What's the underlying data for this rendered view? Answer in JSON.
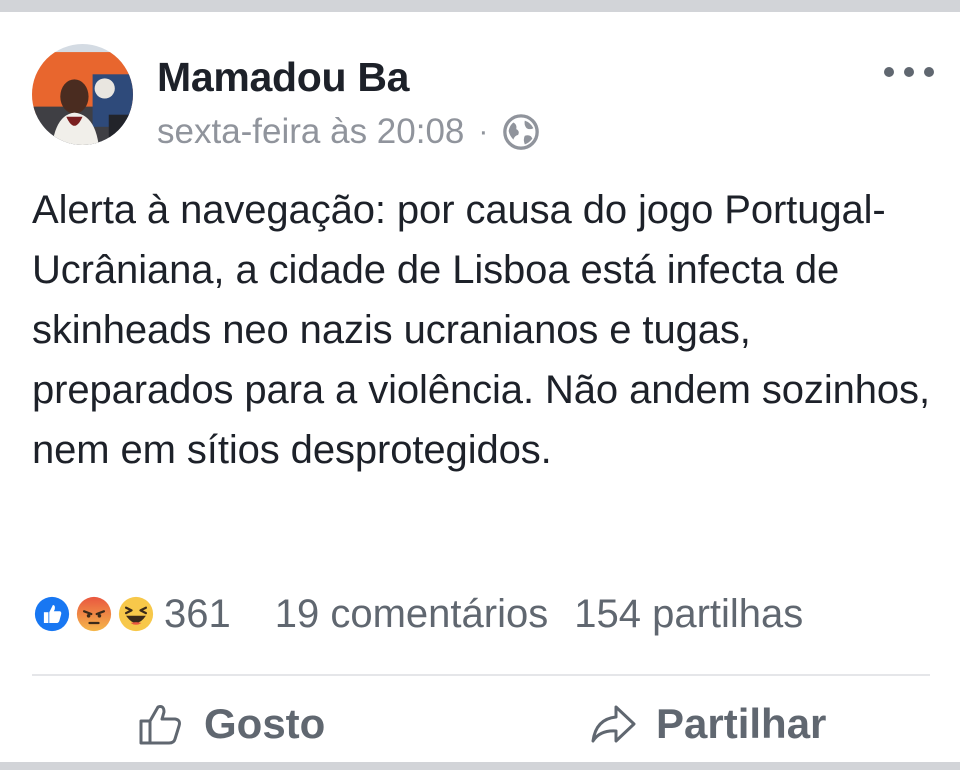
{
  "post": {
    "author": "Mamadou Ba",
    "timestamp": "sexta-feira às 20:08",
    "separator": "·",
    "privacy_icon": "globe-icon",
    "more_icon": "more-options-icon",
    "text": "Alerta à navegação: por causa do jogo Portugal-Ucrâniana, a cidade de Lisboa está infecta de skinheads neo nazis ucranianos e tugas, preparados para a violência. Não andem sozinhos, nem em sítios desprotegidos."
  },
  "stats": {
    "reaction_icons": [
      "like-reaction-icon",
      "angry-reaction-icon",
      "haha-reaction-icon"
    ],
    "reactions_count": "361",
    "comments": "19 comentários",
    "shares": "154 partilhas"
  },
  "actions": {
    "like_label": "Gosto",
    "like_icon": "thumbs-up-icon",
    "share_label": "Partilhar",
    "share_icon": "share-arrow-icon"
  },
  "colors": {
    "text_primary": "#1d2129",
    "text_secondary": "#90949c",
    "action_gray": "#606770",
    "like_blue": "#1877f2",
    "angry_red": "#e9573f",
    "haha_yellow": "#f7c84a"
  }
}
